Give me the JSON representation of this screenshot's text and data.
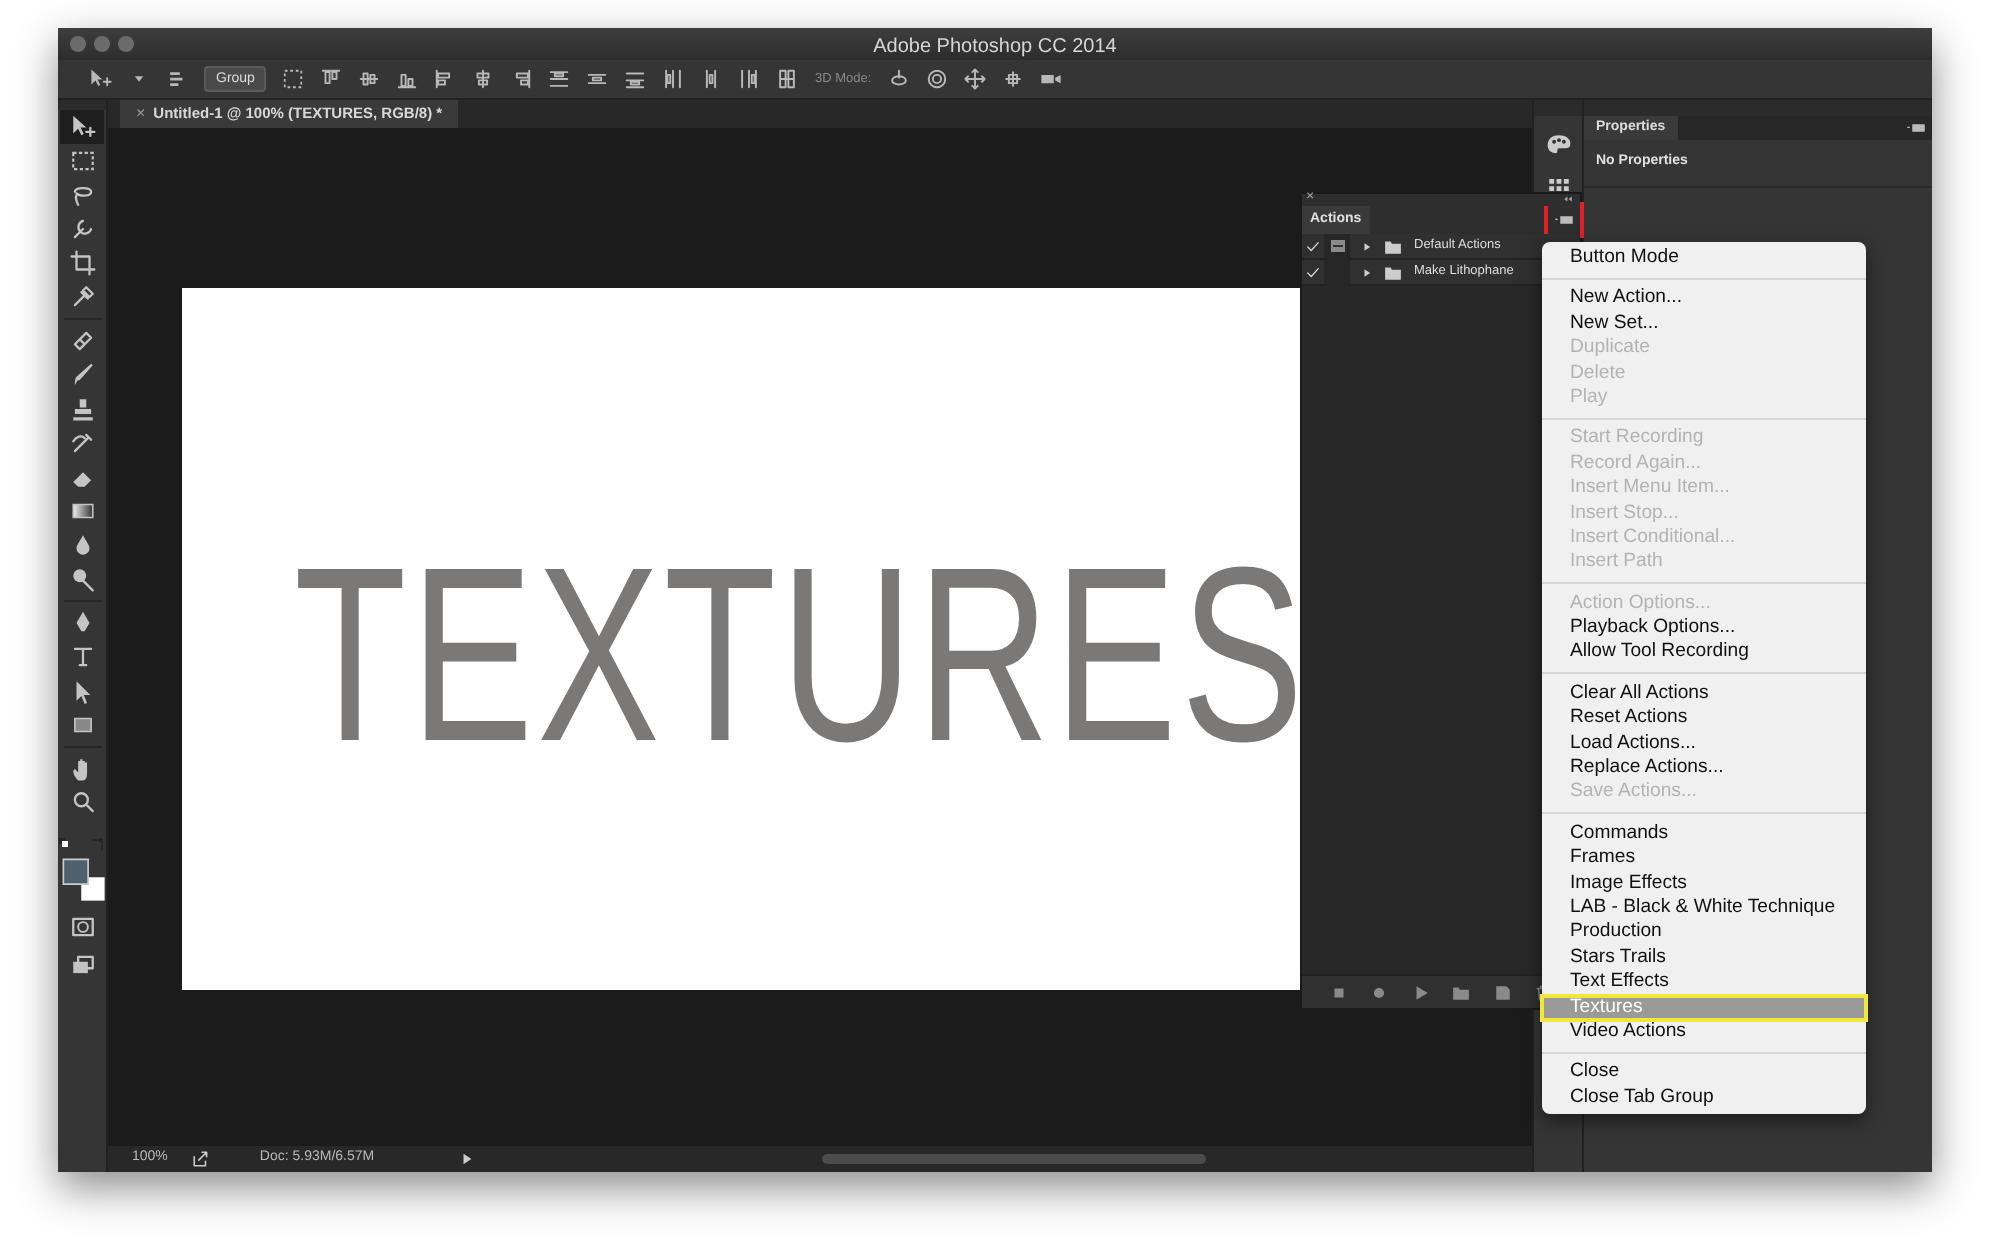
{
  "window": {
    "title": "Adobe Photoshop CC 2014"
  },
  "options_bar": {
    "arrange": "Group",
    "mode_label": "3D Mode:"
  },
  "tools": [
    {
      "kind": "move",
      "selected": true
    },
    {
      "kind": "marquee",
      "selected": false
    },
    {
      "kind": "lasso",
      "selected": false
    },
    {
      "kind": "quick-select",
      "selected": false
    },
    {
      "kind": "crop",
      "selected": false
    },
    {
      "kind": "eyedropper",
      "selected": false
    },
    {
      "kind": "healing",
      "selected": false
    },
    {
      "kind": "brush",
      "selected": false
    },
    {
      "kind": "stamp",
      "selected": false
    },
    {
      "kind": "history-brush",
      "selected": false
    },
    {
      "kind": "eraser",
      "selected": false
    },
    {
      "kind": "gradient",
      "selected": false
    },
    {
      "kind": "blur",
      "selected": false
    },
    {
      "kind": "dodge",
      "selected": false
    },
    {
      "kind": "pen",
      "selected": false
    },
    {
      "kind": "type",
      "selected": false
    },
    {
      "kind": "path-select",
      "selected": false
    },
    {
      "kind": "shape",
      "selected": false
    },
    {
      "kind": "hand",
      "selected": false
    },
    {
      "kind": "zoom",
      "selected": false
    }
  ],
  "document": {
    "close": "×",
    "tab_title": "Untitled-1 @ 100% (TEXTURES, RGB/8) *",
    "canvas_text": "TEXTURES"
  },
  "actions_panel": {
    "close": "×",
    "title": "Actions",
    "menu_button_highlighted": true,
    "rows": [
      {
        "name": "Default Actions",
        "checked": true,
        "dialog": true
      },
      {
        "name": "Make Lithophane",
        "checked": true,
        "dialog": false
      }
    ]
  },
  "panel_menu": {
    "sections": [
      [
        {
          "label": "Button Mode",
          "disabled": false,
          "selected": false,
          "highlighted": false
        }
      ],
      [
        {
          "label": "New Action...",
          "disabled": false,
          "selected": false,
          "highlighted": false
        },
        {
          "label": "New Set...",
          "disabled": false,
          "selected": false,
          "highlighted": false
        },
        {
          "label": "Duplicate",
          "disabled": true,
          "selected": false,
          "highlighted": false
        },
        {
          "label": "Delete",
          "disabled": true,
          "selected": false,
          "highlighted": false
        },
        {
          "label": "Play",
          "disabled": true,
          "selected": false,
          "highlighted": false
        }
      ],
      [
        {
          "label": "Start Recording",
          "disabled": true,
          "selected": false,
          "highlighted": false
        },
        {
          "label": "Record Again...",
          "disabled": true,
          "selected": false,
          "highlighted": false
        },
        {
          "label": "Insert Menu Item...",
          "disabled": true,
          "selected": false,
          "highlighted": false
        },
        {
          "label": "Insert Stop...",
          "disabled": true,
          "selected": false,
          "highlighted": false
        },
        {
          "label": "Insert Conditional...",
          "disabled": true,
          "selected": false,
          "highlighted": false
        },
        {
          "label": "Insert Path",
          "disabled": true,
          "selected": false,
          "highlighted": false
        }
      ],
      [
        {
          "label": "Action Options...",
          "disabled": true,
          "selected": false,
          "highlighted": false
        },
        {
          "label": "Playback Options...",
          "disabled": false,
          "selected": false,
          "highlighted": false
        },
        {
          "label": "Allow Tool Recording",
          "disabled": false,
          "selected": false,
          "highlighted": false
        }
      ],
      [
        {
          "label": "Clear All Actions",
          "disabled": false,
          "selected": false,
          "highlighted": false
        },
        {
          "label": "Reset Actions",
          "disabled": false,
          "selected": false,
          "highlighted": false
        },
        {
          "label": "Load Actions...",
          "disabled": false,
          "selected": false,
          "highlighted": false
        },
        {
          "label": "Replace Actions...",
          "disabled": false,
          "selected": false,
          "highlighted": false
        },
        {
          "label": "Save Actions...",
          "disabled": true,
          "selected": false,
          "highlighted": false
        }
      ],
      [
        {
          "label": "Commands",
          "disabled": false,
          "selected": false,
          "highlighted": false
        },
        {
          "label": "Frames",
          "disabled": false,
          "selected": false,
          "highlighted": false
        },
        {
          "label": "Image Effects",
          "disabled": false,
          "selected": false,
          "highlighted": false
        },
        {
          "label": "LAB - Black & White Technique",
          "disabled": false,
          "selected": false,
          "highlighted": false
        },
        {
          "label": "Production",
          "disabled": false,
          "selected": false,
          "highlighted": false
        },
        {
          "label": "Stars Trails",
          "disabled": false,
          "selected": false,
          "highlighted": false
        },
        {
          "label": "Text Effects",
          "disabled": false,
          "selected": false,
          "highlighted": false
        },
        {
          "label": "Textures",
          "disabled": false,
          "selected": true,
          "highlighted": true
        },
        {
          "label": "Video Actions",
          "disabled": false,
          "selected": false,
          "highlighted": false
        }
      ],
      [
        {
          "label": "Close",
          "disabled": false,
          "selected": false,
          "highlighted": false
        },
        {
          "label": "Close Tab Group",
          "disabled": false,
          "selected": false,
          "highlighted": false
        }
      ]
    ]
  },
  "properties_panel": {
    "title": "Properties",
    "message": "No Properties"
  },
  "status_bar": {
    "zoom": "100%",
    "doc_info": "Doc: 5.93M/6.57M"
  }
}
